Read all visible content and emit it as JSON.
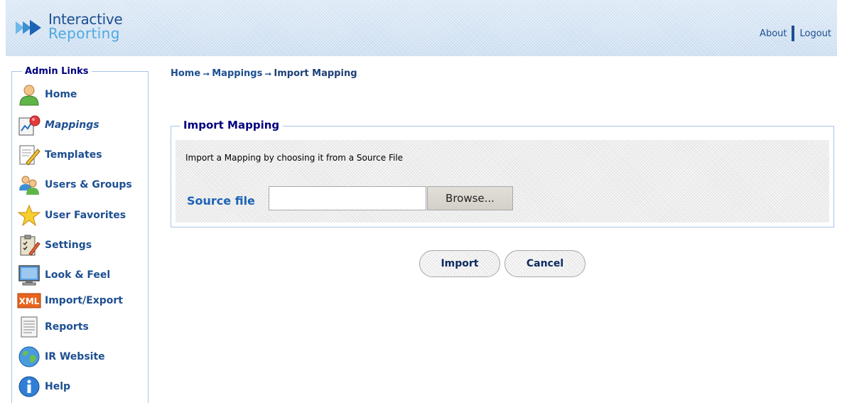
{
  "header": {
    "logo_line1": "Interactive",
    "logo_line2": "Reporting",
    "about_label": "About",
    "logout_label": "Logout"
  },
  "sidebar": {
    "title": "Admin Links",
    "items": [
      {
        "label": "Home",
        "icon": "user-icon"
      },
      {
        "label": "Mappings",
        "icon": "mappings-icon",
        "active": true
      },
      {
        "label": "Templates",
        "icon": "template-icon"
      },
      {
        "label": "Users & Groups",
        "icon": "users-groups-icon"
      },
      {
        "label": "User Favorites",
        "icon": "star-icon"
      },
      {
        "label": "Settings",
        "icon": "settings-clipboard-icon"
      },
      {
        "label": "Look & Feel",
        "icon": "monitor-icon"
      },
      {
        "label": "Import/Export",
        "icon": "xml-icon"
      },
      {
        "label": "Reports",
        "icon": "report-document-icon"
      },
      {
        "label": "IR Website",
        "icon": "globe-icon"
      },
      {
        "label": "Help",
        "icon": "info-icon"
      }
    ]
  },
  "breadcrumb": {
    "home": "Home",
    "mappings": "Mappings",
    "current": "Import Mapping",
    "arrow": "➞"
  },
  "panel": {
    "title": "Import Mapping",
    "description": "Import a Mapping by choosing it from a Source File",
    "field_label": "Source file",
    "file_value": "",
    "browse_label": "Browse..."
  },
  "actions": {
    "import_label": "Import",
    "cancel_label": "Cancel"
  },
  "colors": {
    "link_blue": "#1d4f91",
    "title_navy": "#000080",
    "border_blue": "#a9c4e4"
  }
}
